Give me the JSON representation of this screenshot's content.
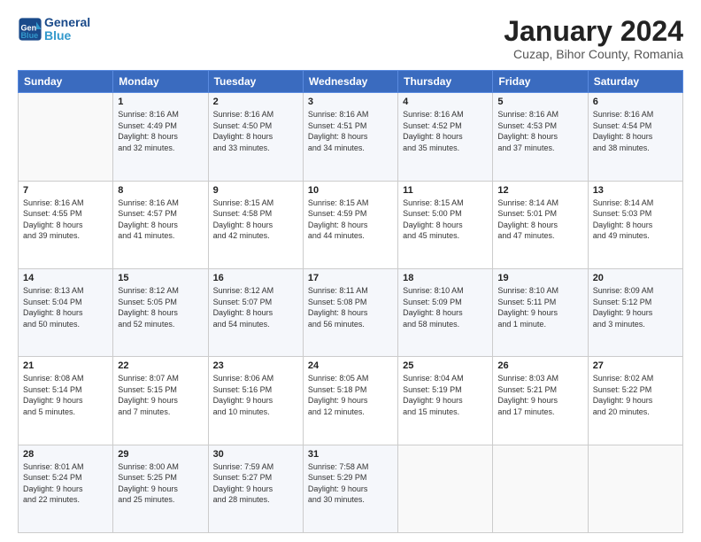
{
  "header": {
    "logo_line1": "General",
    "logo_line2": "Blue",
    "title": "January 2024",
    "subtitle": "Cuzap, Bihor County, Romania"
  },
  "days_of_week": [
    "Sunday",
    "Monday",
    "Tuesday",
    "Wednesday",
    "Thursday",
    "Friday",
    "Saturday"
  ],
  "weeks": [
    [
      {
        "day": "",
        "info": ""
      },
      {
        "day": "1",
        "info": "Sunrise: 8:16 AM\nSunset: 4:49 PM\nDaylight: 8 hours\nand 32 minutes."
      },
      {
        "day": "2",
        "info": "Sunrise: 8:16 AM\nSunset: 4:50 PM\nDaylight: 8 hours\nand 33 minutes."
      },
      {
        "day": "3",
        "info": "Sunrise: 8:16 AM\nSunset: 4:51 PM\nDaylight: 8 hours\nand 34 minutes."
      },
      {
        "day": "4",
        "info": "Sunrise: 8:16 AM\nSunset: 4:52 PM\nDaylight: 8 hours\nand 35 minutes."
      },
      {
        "day": "5",
        "info": "Sunrise: 8:16 AM\nSunset: 4:53 PM\nDaylight: 8 hours\nand 37 minutes."
      },
      {
        "day": "6",
        "info": "Sunrise: 8:16 AM\nSunset: 4:54 PM\nDaylight: 8 hours\nand 38 minutes."
      }
    ],
    [
      {
        "day": "7",
        "info": "Sunrise: 8:16 AM\nSunset: 4:55 PM\nDaylight: 8 hours\nand 39 minutes."
      },
      {
        "day": "8",
        "info": "Sunrise: 8:16 AM\nSunset: 4:57 PM\nDaylight: 8 hours\nand 41 minutes."
      },
      {
        "day": "9",
        "info": "Sunrise: 8:15 AM\nSunset: 4:58 PM\nDaylight: 8 hours\nand 42 minutes."
      },
      {
        "day": "10",
        "info": "Sunrise: 8:15 AM\nSunset: 4:59 PM\nDaylight: 8 hours\nand 44 minutes."
      },
      {
        "day": "11",
        "info": "Sunrise: 8:15 AM\nSunset: 5:00 PM\nDaylight: 8 hours\nand 45 minutes."
      },
      {
        "day": "12",
        "info": "Sunrise: 8:14 AM\nSunset: 5:01 PM\nDaylight: 8 hours\nand 47 minutes."
      },
      {
        "day": "13",
        "info": "Sunrise: 8:14 AM\nSunset: 5:03 PM\nDaylight: 8 hours\nand 49 minutes."
      }
    ],
    [
      {
        "day": "14",
        "info": "Sunrise: 8:13 AM\nSunset: 5:04 PM\nDaylight: 8 hours\nand 50 minutes."
      },
      {
        "day": "15",
        "info": "Sunrise: 8:12 AM\nSunset: 5:05 PM\nDaylight: 8 hours\nand 52 minutes."
      },
      {
        "day": "16",
        "info": "Sunrise: 8:12 AM\nSunset: 5:07 PM\nDaylight: 8 hours\nand 54 minutes."
      },
      {
        "day": "17",
        "info": "Sunrise: 8:11 AM\nSunset: 5:08 PM\nDaylight: 8 hours\nand 56 minutes."
      },
      {
        "day": "18",
        "info": "Sunrise: 8:10 AM\nSunset: 5:09 PM\nDaylight: 8 hours\nand 58 minutes."
      },
      {
        "day": "19",
        "info": "Sunrise: 8:10 AM\nSunset: 5:11 PM\nDaylight: 9 hours\nand 1 minute."
      },
      {
        "day": "20",
        "info": "Sunrise: 8:09 AM\nSunset: 5:12 PM\nDaylight: 9 hours\nand 3 minutes."
      }
    ],
    [
      {
        "day": "21",
        "info": "Sunrise: 8:08 AM\nSunset: 5:14 PM\nDaylight: 9 hours\nand 5 minutes."
      },
      {
        "day": "22",
        "info": "Sunrise: 8:07 AM\nSunset: 5:15 PM\nDaylight: 9 hours\nand 7 minutes."
      },
      {
        "day": "23",
        "info": "Sunrise: 8:06 AM\nSunset: 5:16 PM\nDaylight: 9 hours\nand 10 minutes."
      },
      {
        "day": "24",
        "info": "Sunrise: 8:05 AM\nSunset: 5:18 PM\nDaylight: 9 hours\nand 12 minutes."
      },
      {
        "day": "25",
        "info": "Sunrise: 8:04 AM\nSunset: 5:19 PM\nDaylight: 9 hours\nand 15 minutes."
      },
      {
        "day": "26",
        "info": "Sunrise: 8:03 AM\nSunset: 5:21 PM\nDaylight: 9 hours\nand 17 minutes."
      },
      {
        "day": "27",
        "info": "Sunrise: 8:02 AM\nSunset: 5:22 PM\nDaylight: 9 hours\nand 20 minutes."
      }
    ],
    [
      {
        "day": "28",
        "info": "Sunrise: 8:01 AM\nSunset: 5:24 PM\nDaylight: 9 hours\nand 22 minutes."
      },
      {
        "day": "29",
        "info": "Sunrise: 8:00 AM\nSunset: 5:25 PM\nDaylight: 9 hours\nand 25 minutes."
      },
      {
        "day": "30",
        "info": "Sunrise: 7:59 AM\nSunset: 5:27 PM\nDaylight: 9 hours\nand 28 minutes."
      },
      {
        "day": "31",
        "info": "Sunrise: 7:58 AM\nSunset: 5:29 PM\nDaylight: 9 hours\nand 30 minutes."
      },
      {
        "day": "",
        "info": ""
      },
      {
        "day": "",
        "info": ""
      },
      {
        "day": "",
        "info": ""
      }
    ]
  ]
}
